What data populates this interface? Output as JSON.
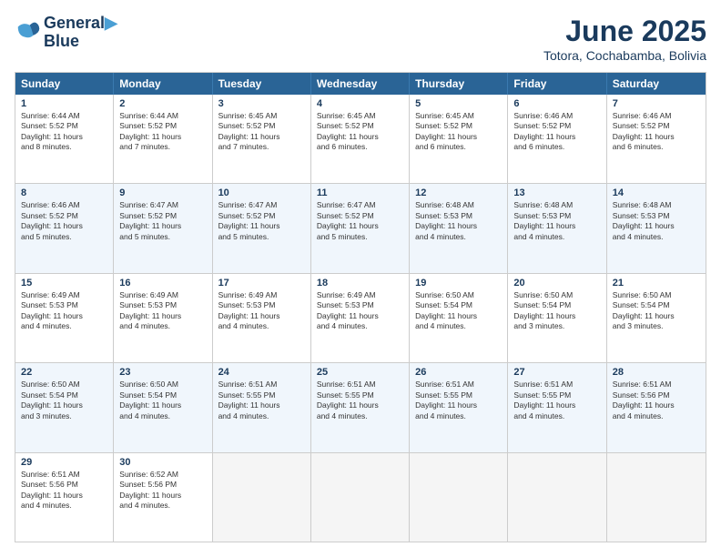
{
  "logo": {
    "line1": "General",
    "line2": "Blue"
  },
  "title": "June 2025",
  "location": "Totora, Cochabamba, Bolivia",
  "headers": [
    "Sunday",
    "Monday",
    "Tuesday",
    "Wednesday",
    "Thursday",
    "Friday",
    "Saturday"
  ],
  "rows": [
    [
      {
        "day": "",
        "empty": true
      },
      {
        "day": "",
        "empty": true
      },
      {
        "day": "",
        "empty": true
      },
      {
        "day": "",
        "empty": true
      },
      {
        "day": "",
        "empty": true
      },
      {
        "day": "",
        "empty": true
      },
      {
        "day": "",
        "empty": true
      }
    ],
    [
      {
        "day": "1",
        "info": "Sunrise: 6:44 AM\nSunset: 5:52 PM\nDaylight: 11 hours\nand 8 minutes."
      },
      {
        "day": "2",
        "info": "Sunrise: 6:44 AM\nSunset: 5:52 PM\nDaylight: 11 hours\nand 7 minutes."
      },
      {
        "day": "3",
        "info": "Sunrise: 6:45 AM\nSunset: 5:52 PM\nDaylight: 11 hours\nand 7 minutes."
      },
      {
        "day": "4",
        "info": "Sunrise: 6:45 AM\nSunset: 5:52 PM\nDaylight: 11 hours\nand 6 minutes."
      },
      {
        "day": "5",
        "info": "Sunrise: 6:45 AM\nSunset: 5:52 PM\nDaylight: 11 hours\nand 6 minutes."
      },
      {
        "day": "6",
        "info": "Sunrise: 6:46 AM\nSunset: 5:52 PM\nDaylight: 11 hours\nand 6 minutes."
      },
      {
        "day": "7",
        "info": "Sunrise: 6:46 AM\nSunset: 5:52 PM\nDaylight: 11 hours\nand 6 minutes."
      }
    ],
    [
      {
        "day": "8",
        "info": "Sunrise: 6:46 AM\nSunset: 5:52 PM\nDaylight: 11 hours\nand 5 minutes."
      },
      {
        "day": "9",
        "info": "Sunrise: 6:47 AM\nSunset: 5:52 PM\nDaylight: 11 hours\nand 5 minutes."
      },
      {
        "day": "10",
        "info": "Sunrise: 6:47 AM\nSunset: 5:52 PM\nDaylight: 11 hours\nand 5 minutes."
      },
      {
        "day": "11",
        "info": "Sunrise: 6:47 AM\nSunset: 5:52 PM\nDaylight: 11 hours\nand 5 minutes."
      },
      {
        "day": "12",
        "info": "Sunrise: 6:48 AM\nSunset: 5:53 PM\nDaylight: 11 hours\nand 4 minutes."
      },
      {
        "day": "13",
        "info": "Sunrise: 6:48 AM\nSunset: 5:53 PM\nDaylight: 11 hours\nand 4 minutes."
      },
      {
        "day": "14",
        "info": "Sunrise: 6:48 AM\nSunset: 5:53 PM\nDaylight: 11 hours\nand 4 minutes."
      }
    ],
    [
      {
        "day": "15",
        "info": "Sunrise: 6:49 AM\nSunset: 5:53 PM\nDaylight: 11 hours\nand 4 minutes."
      },
      {
        "day": "16",
        "info": "Sunrise: 6:49 AM\nSunset: 5:53 PM\nDaylight: 11 hours\nand 4 minutes."
      },
      {
        "day": "17",
        "info": "Sunrise: 6:49 AM\nSunset: 5:53 PM\nDaylight: 11 hours\nand 4 minutes."
      },
      {
        "day": "18",
        "info": "Sunrise: 6:49 AM\nSunset: 5:53 PM\nDaylight: 11 hours\nand 4 minutes."
      },
      {
        "day": "19",
        "info": "Sunrise: 6:50 AM\nSunset: 5:54 PM\nDaylight: 11 hours\nand 4 minutes."
      },
      {
        "day": "20",
        "info": "Sunrise: 6:50 AM\nSunset: 5:54 PM\nDaylight: 11 hours\nand 3 minutes."
      },
      {
        "day": "21",
        "info": "Sunrise: 6:50 AM\nSunset: 5:54 PM\nDaylight: 11 hours\nand 3 minutes."
      }
    ],
    [
      {
        "day": "22",
        "info": "Sunrise: 6:50 AM\nSunset: 5:54 PM\nDaylight: 11 hours\nand 3 minutes."
      },
      {
        "day": "23",
        "info": "Sunrise: 6:50 AM\nSunset: 5:54 PM\nDaylight: 11 hours\nand 4 minutes."
      },
      {
        "day": "24",
        "info": "Sunrise: 6:51 AM\nSunset: 5:55 PM\nDaylight: 11 hours\nand 4 minutes."
      },
      {
        "day": "25",
        "info": "Sunrise: 6:51 AM\nSunset: 5:55 PM\nDaylight: 11 hours\nand 4 minutes."
      },
      {
        "day": "26",
        "info": "Sunrise: 6:51 AM\nSunset: 5:55 PM\nDaylight: 11 hours\nand 4 minutes."
      },
      {
        "day": "27",
        "info": "Sunrise: 6:51 AM\nSunset: 5:55 PM\nDaylight: 11 hours\nand 4 minutes."
      },
      {
        "day": "28",
        "info": "Sunrise: 6:51 AM\nSunset: 5:56 PM\nDaylight: 11 hours\nand 4 minutes."
      }
    ],
    [
      {
        "day": "29",
        "info": "Sunrise: 6:51 AM\nSunset: 5:56 PM\nDaylight: 11 hours\nand 4 minutes."
      },
      {
        "day": "30",
        "info": "Sunrise: 6:52 AM\nSunset: 5:56 PM\nDaylight: 11 hours\nand 4 minutes."
      },
      {
        "day": "",
        "empty": true
      },
      {
        "day": "",
        "empty": true
      },
      {
        "day": "",
        "empty": true
      },
      {
        "day": "",
        "empty": true
      },
      {
        "day": "",
        "empty": true
      }
    ]
  ]
}
